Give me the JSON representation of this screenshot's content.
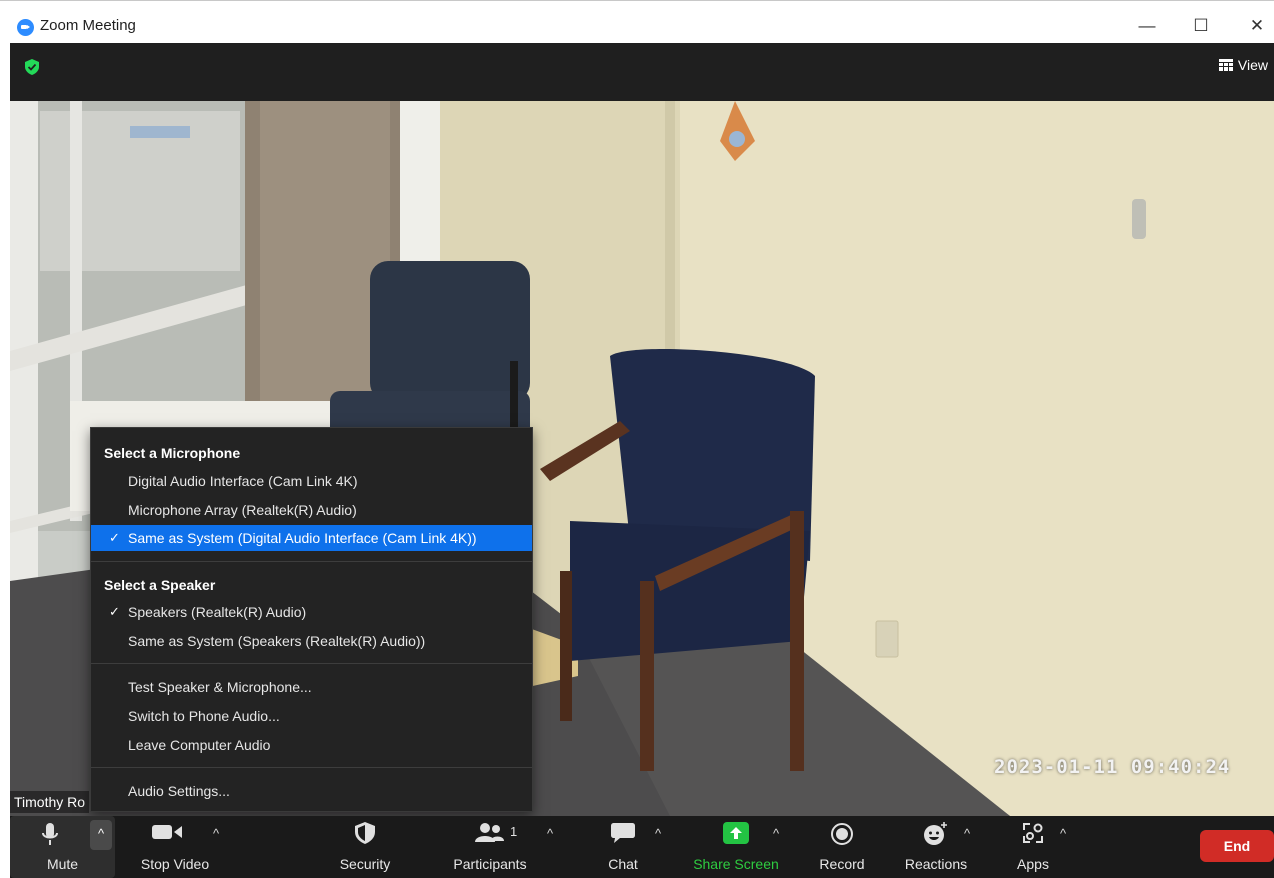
{
  "window": {
    "title": "Zoom Meeting",
    "minimize": "—",
    "maximize": "☐",
    "close": "✕"
  },
  "header": {
    "view_label": "View"
  },
  "video": {
    "timestamp": "2023-01-11  09:40:24",
    "participant_name": "Timothy Ro"
  },
  "audio_menu": {
    "mic_heading": "Select a Microphone",
    "mic_options": [
      {
        "label": "Digital Audio Interface (Cam Link 4K)",
        "checked": false
      },
      {
        "label": "Microphone Array (Realtek(R) Audio)",
        "checked": false
      },
      {
        "label": "Same as System (Digital Audio Interface (Cam Link 4K))",
        "checked": true
      }
    ],
    "speaker_heading": "Select a Speaker",
    "speaker_options": [
      {
        "label": "Speakers (Realtek(R) Audio)",
        "checked": true
      },
      {
        "label": "Same as System (Speakers (Realtek(R) Audio))",
        "checked": false
      }
    ],
    "actions": [
      {
        "label": "Test Speaker & Microphone..."
      },
      {
        "label": "Switch to Phone Audio..."
      },
      {
        "label": "Leave Computer Audio"
      }
    ],
    "settings": "Audio Settings...",
    "check_glyph": "✓"
  },
  "toolbar": {
    "mute": "Mute",
    "stop_video": "Stop Video",
    "security": "Security",
    "participants": "Participants",
    "participants_count": "1",
    "chat": "Chat",
    "share_screen": "Share Screen",
    "record": "Record",
    "reactions": "Reactions",
    "apps": "Apps",
    "end": "End",
    "caret": "^"
  },
  "colors": {
    "accent": "#0e71eb",
    "end": "#d12c26",
    "share": "#2ecc40",
    "zoom_blue": "#2d8cff"
  }
}
